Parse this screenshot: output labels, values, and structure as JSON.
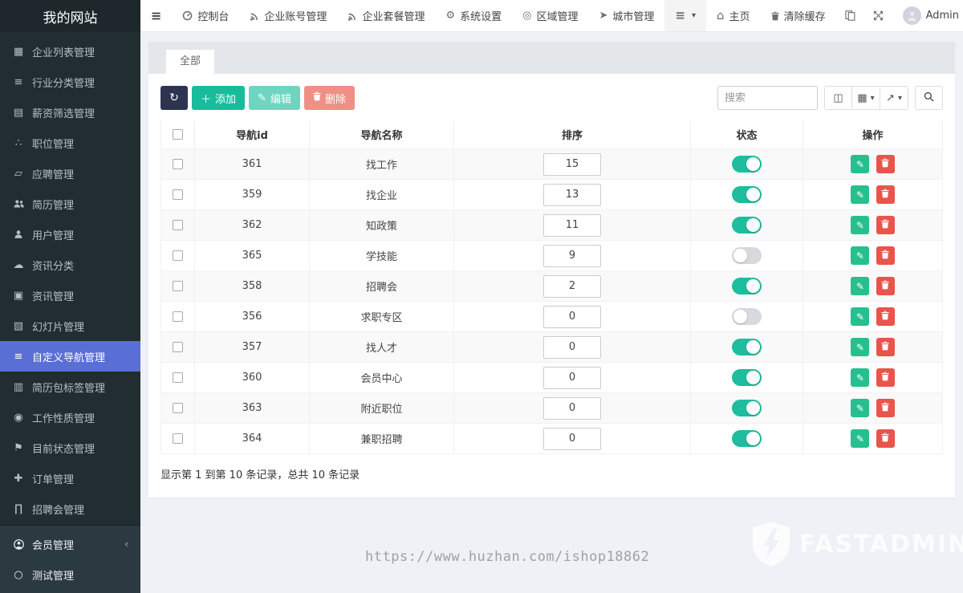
{
  "brand": {
    "title": "我的网站"
  },
  "icons": {
    "hamburger": "≡",
    "cogs": "⚙",
    "marker": "◎",
    "send": "➤",
    "list": "≡",
    "home": "⌂",
    "caret": "▾",
    "bars": "≡",
    "table": "▦",
    "th_list": "▤",
    "sitemap": "∴",
    "map": "▱",
    "cloud": "☁",
    "comments": "▣",
    "image": "▧",
    "id_card": "▥",
    "circle_dot": "◉",
    "flag": "⚑",
    "move": "✚",
    "bank": "∏",
    "circle_o": "○",
    "refresh": "↻",
    "plus": "＋",
    "pencil": "✎",
    "card_view": "◫",
    "columns": "▦",
    "export": "↗",
    "chevron_left": "‹"
  },
  "topnav": {
    "menu": [
      {
        "icon": "dashboard",
        "label": "控制台"
      },
      {
        "icon": "rss",
        "label": "企业账号管理"
      },
      {
        "icon": "rss",
        "label": "企业套餐管理"
      },
      {
        "icon": "cogs",
        "label": "系统设置"
      },
      {
        "icon": "marker",
        "label": "区域管理"
      },
      {
        "icon": "send",
        "label": "城市管理"
      }
    ],
    "right": {
      "home_label": "主页",
      "clear_cache_label": "清除缓存",
      "username": "Admin"
    }
  },
  "sidebar": {
    "main_items": [
      {
        "icon": "table",
        "label": "企业列表管理",
        "active": false
      },
      {
        "icon": "bars",
        "label": "行业分类管理",
        "active": false
      },
      {
        "icon": "th_list",
        "label": "薪资筛选管理",
        "active": false
      },
      {
        "icon": "sitemap",
        "label": "职位管理",
        "active": false
      },
      {
        "icon": "map",
        "label": "应聘管理",
        "active": false
      },
      {
        "icon": "users",
        "label": "简历管理",
        "active": false
      },
      {
        "icon": "user",
        "label": "用户管理",
        "active": false
      },
      {
        "icon": "cloud",
        "label": "资讯分类",
        "active": false
      },
      {
        "icon": "comments",
        "label": "资讯管理",
        "active": false
      },
      {
        "icon": "image",
        "label": "幻灯片管理",
        "active": false
      },
      {
        "icon": "bars",
        "label": "自定义导航管理",
        "active": true
      },
      {
        "icon": "id_card",
        "label": "简历包标签管理",
        "active": false
      },
      {
        "icon": "circle_dot",
        "label": "工作性质管理",
        "active": false
      },
      {
        "icon": "flag",
        "label": "目前状态管理",
        "active": false
      },
      {
        "icon": "move",
        "label": "订单管理",
        "active": false
      },
      {
        "icon": "bank",
        "label": "招聘会管理",
        "active": false
      }
    ],
    "bottom_items": [
      {
        "icon": "user_circle",
        "label": "会员管理",
        "chevron": "‹"
      },
      {
        "icon": "circle_o",
        "label": "测试管理",
        "chevron": ""
      }
    ]
  },
  "tabs": {
    "all": "全部"
  },
  "toolbar": {
    "add_label": "添加",
    "edit_label": "编辑",
    "delete_label": "删除",
    "search_placeholder": "搜索"
  },
  "table": {
    "headers": {
      "id": "导航id",
      "name": "导航名称",
      "sort": "排序",
      "status": "状态",
      "ops": "操作"
    },
    "rows": [
      {
        "id": "361",
        "name": "找工作",
        "sort": "15",
        "status": true
      },
      {
        "id": "359",
        "name": "找企业",
        "sort": "13",
        "status": true
      },
      {
        "id": "362",
        "name": "知政策",
        "sort": "11",
        "status": true
      },
      {
        "id": "365",
        "name": "学技能",
        "sort": "9",
        "status": false
      },
      {
        "id": "358",
        "name": "招聘会",
        "sort": "2",
        "status": true
      },
      {
        "id": "356",
        "name": "求职专区",
        "sort": "0",
        "status": false
      },
      {
        "id": "357",
        "name": "找人才",
        "sort": "0",
        "status": true
      },
      {
        "id": "360",
        "name": "会员中心",
        "sort": "0",
        "status": true
      },
      {
        "id": "363",
        "name": "附近职位",
        "sort": "0",
        "status": true
      },
      {
        "id": "364",
        "name": "兼职招聘",
        "sort": "0",
        "status": true
      }
    ]
  },
  "pagination": {
    "summary": "显示第 1 到第 10 条记录，总共 10 条记录"
  },
  "watermark": {
    "url": "https://www.huzhan.com/ishop18862",
    "logo_text": "FASTADMIN"
  },
  "colors": {
    "accent": "#5a6fd6",
    "success": "#18bc9c",
    "danger": "#e74c3c",
    "primary_dark": "#2d3450",
    "sidebar_bg": "#222d32"
  }
}
